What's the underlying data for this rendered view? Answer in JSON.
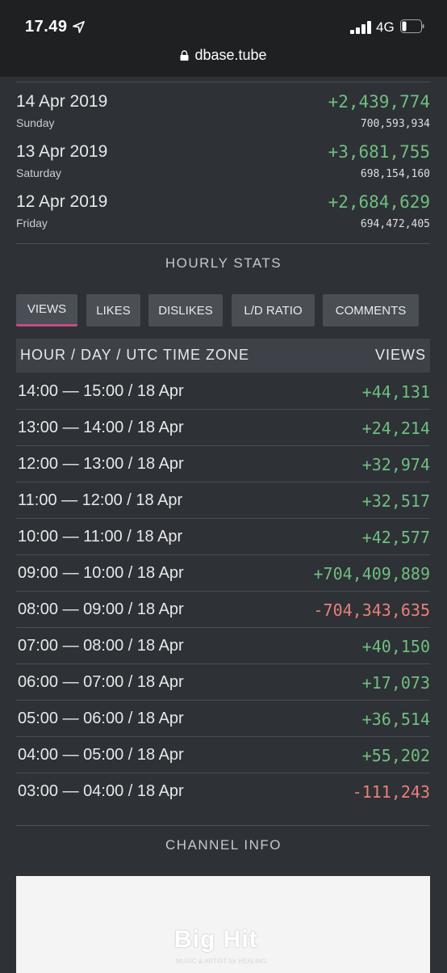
{
  "status_bar": {
    "time": "17.49",
    "network": "4G"
  },
  "browser": {
    "url": "dbase.tube"
  },
  "daily_stats": [
    {
      "date": "14 Apr 2019",
      "weekday": "Sunday",
      "change": "+2,439,774",
      "total": "700,593,934"
    },
    {
      "date": "13 Apr 2019",
      "weekday": "Saturday",
      "change": "+3,681,755",
      "total": "698,154,160"
    },
    {
      "date": "12 Apr 2019",
      "weekday": "Friday",
      "change": "+2,684,629",
      "total": "694,472,405"
    }
  ],
  "hourly": {
    "title": "HOURLY STATS",
    "tabs": [
      "VIEWS",
      "LIKES",
      "DISLIKES",
      "L/D RATIO",
      "COMMENTS"
    ],
    "active_tab": "VIEWS",
    "header_left": "HOUR / DAY / UTC TIME ZONE",
    "header_right": "VIEWS",
    "rows": [
      {
        "label": "14:00 — 15:00 / 18 Apr",
        "value": "+44,131"
      },
      {
        "label": "13:00 — 14:00 / 18 Apr",
        "value": "+24,214"
      },
      {
        "label": "12:00 — 13:00 / 18 Apr",
        "value": "+32,974"
      },
      {
        "label": "11:00 — 12:00 / 18 Apr",
        "value": "+32,517"
      },
      {
        "label": "10:00 — 11:00 / 18 Apr",
        "value": "+42,577"
      },
      {
        "label": "09:00 — 10:00 / 18 Apr",
        "value": "+704,409,889"
      },
      {
        "label": "08:00 — 09:00 / 18 Apr",
        "value": "-704,343,635"
      },
      {
        "label": "07:00 — 08:00 / 18 Apr",
        "value": "+40,150"
      },
      {
        "label": "06:00 — 07:00 / 18 Apr",
        "value": "+17,073"
      },
      {
        "label": "05:00 — 06:00 / 18 Apr",
        "value": "+36,514"
      },
      {
        "label": "04:00 — 05:00 / 18 Apr",
        "value": "+55,202"
      },
      {
        "label": "03:00 — 04:00 / 18 Apr",
        "value": "-111,243"
      }
    ]
  },
  "channel_info": {
    "title": "CHANNEL INFO",
    "logo_text": "Big Hit",
    "logo_subtext": "MUSIC & ARTIST for HEALING"
  },
  "colors": {
    "positive": "#6fbf80",
    "negative": "#e8817b",
    "accent": "#c94b86",
    "background": "#2e3136"
  },
  "icons": [
    "location-arrow-icon",
    "signal-bars-icon",
    "battery-icon",
    "lock-icon"
  ]
}
